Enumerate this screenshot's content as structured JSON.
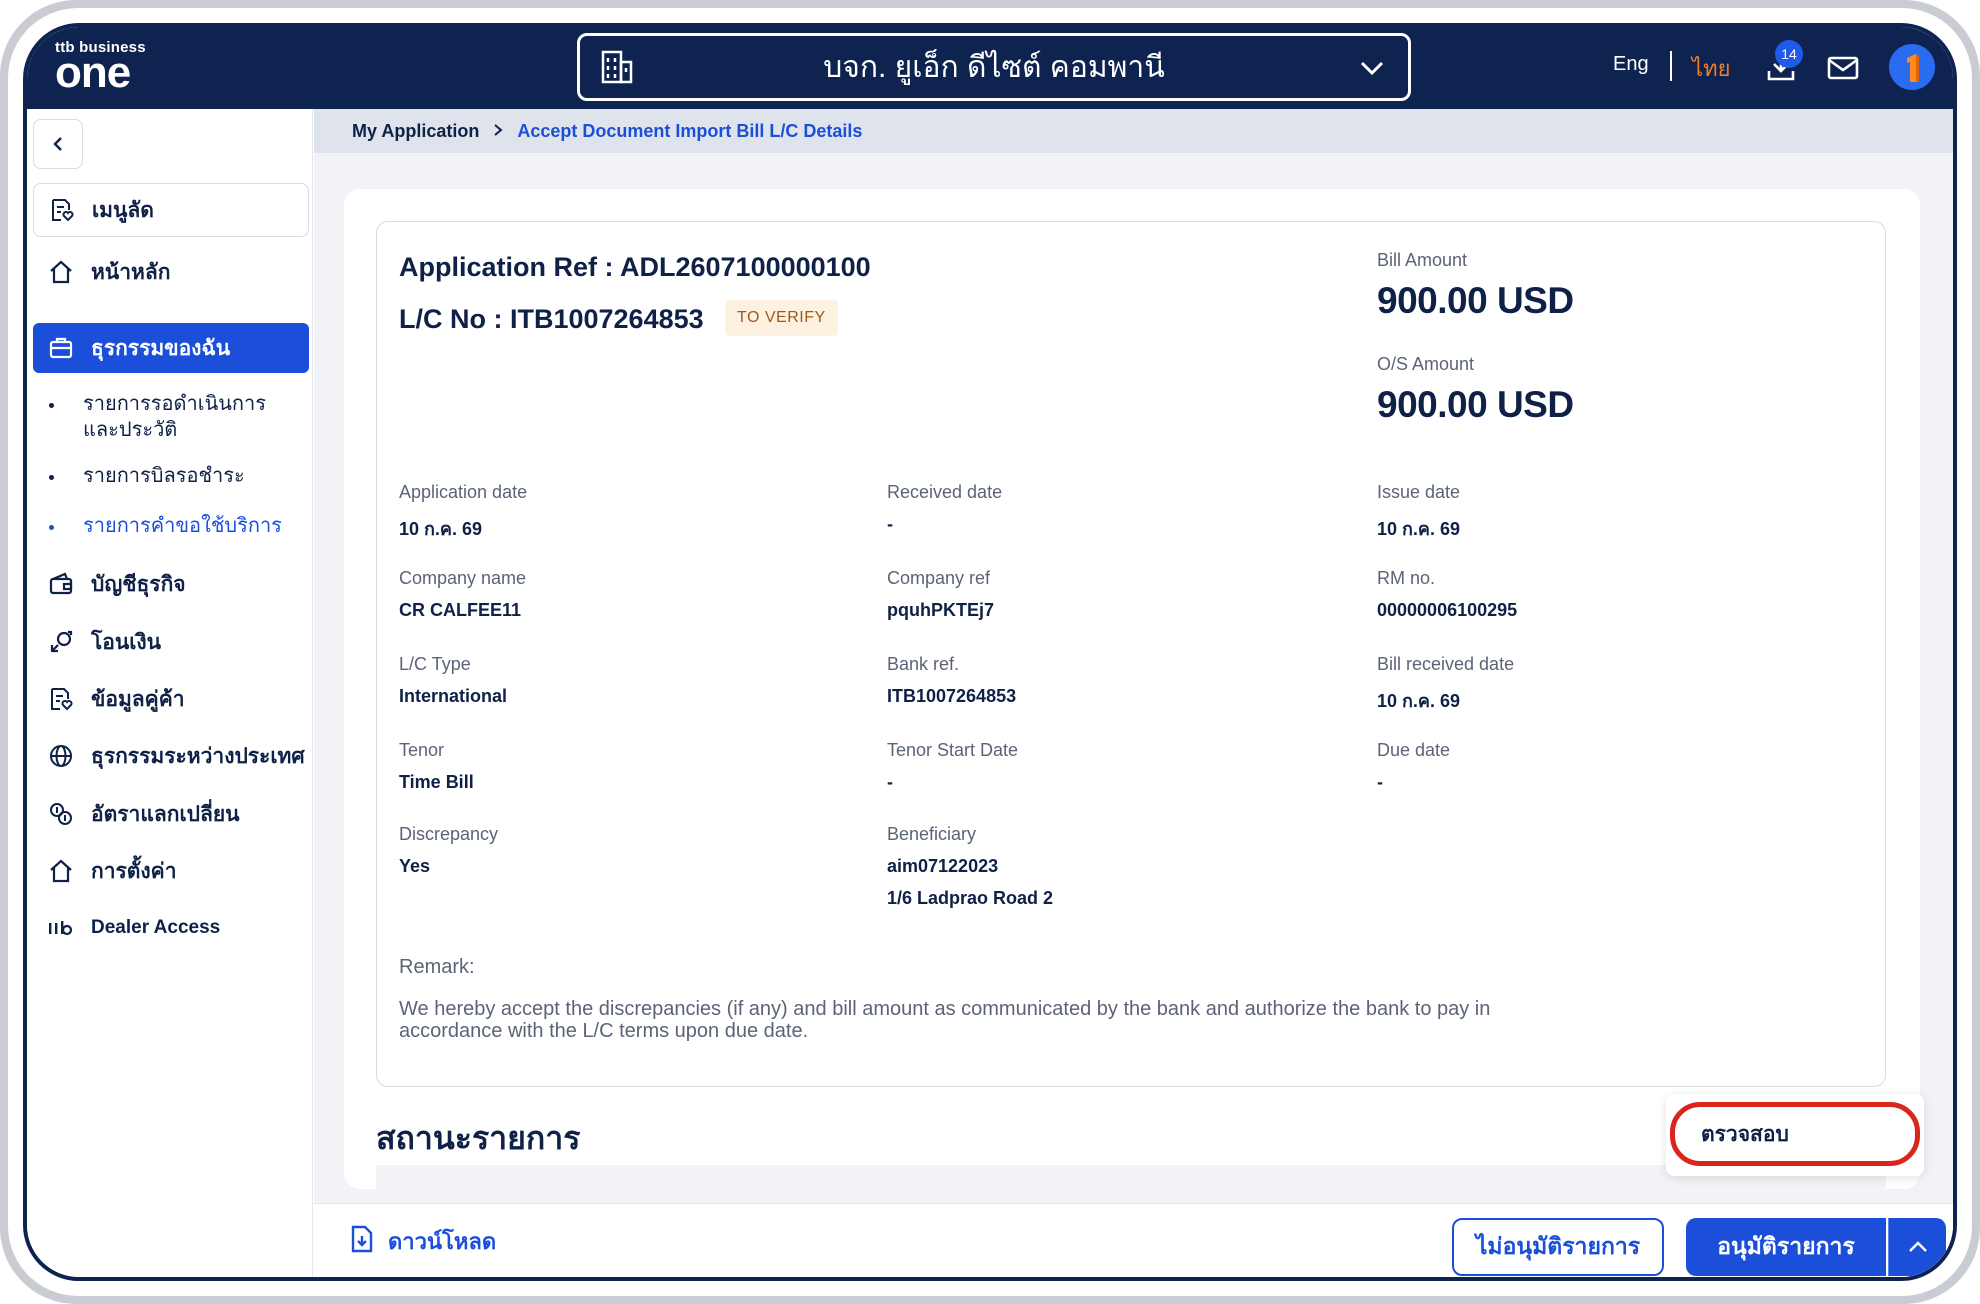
{
  "header": {
    "logo_small": "ttb business",
    "logo_big": "one",
    "company_name": "บจก. ยูเอ็ก ดีไซต์ คอมพานี",
    "lang_en": "Eng",
    "lang_th": "ไทย",
    "download_badge": "14"
  },
  "sidebar": {
    "shortcut_label": "เมนูลัด",
    "items": [
      {
        "label": "หน้าหลัก"
      },
      {
        "label": "ธุรกรรมของฉัน"
      },
      {
        "label": "บัญชีธุรกิจ"
      },
      {
        "label": "โอนเงิน"
      },
      {
        "label": "ข้อมูลคู่ค้า"
      },
      {
        "label": "ธุรกรรมระหว่างประเทศ"
      },
      {
        "label": "อัตราแลกเปลี่ยน"
      },
      {
        "label": "การตั้งค่า"
      },
      {
        "label": "Dealer Access"
      }
    ],
    "sub_items": [
      {
        "label": "รายการรอดำเนินการ และประวัติ"
      },
      {
        "label": "รายการบิลรอชำระ"
      },
      {
        "label": "รายการคำขอใช้บริการ"
      }
    ]
  },
  "breadcrumb": {
    "parent": "My Application",
    "current": "Accept Document Import Bill L/C Details"
  },
  "details": {
    "app_ref": "Application Ref : ADL2607100000100",
    "lc_no": "L/C No : ITB1007264853",
    "status": "TO VERIFY",
    "bill_amount_label": "Bill Amount",
    "bill_amount": "900.00 USD",
    "os_amount_label": "O/S Amount",
    "os_amount": "900.00 USD",
    "fields": [
      {
        "label": "Application date",
        "value": "10 ก.ค. 69"
      },
      {
        "label": "Received date",
        "value": "-"
      },
      {
        "label": "Issue date",
        "value": "10 ก.ค. 69"
      },
      {
        "label": "Company name",
        "value": "CR CALFEE11"
      },
      {
        "label": "Company ref",
        "value": "pquhPKTEj7"
      },
      {
        "label": "RM no.",
        "value": "00000006100295"
      },
      {
        "label": "L/C Type",
        "value": "International"
      },
      {
        "label": "Bank ref.",
        "value": "ITB1007264853"
      },
      {
        "label": "Bill received date",
        "value": "10 ก.ค. 69"
      },
      {
        "label": "Tenor",
        "value": "Time Bill"
      },
      {
        "label": "Tenor Start Date",
        "value": "-"
      },
      {
        "label": "Due date",
        "value": "-"
      },
      {
        "label": "Discrepancy",
        "value": "Yes"
      },
      {
        "label": "Beneficiary",
        "value": "aim07122023",
        "value2": "1/6 Ladprao Road 2"
      }
    ],
    "remark_label": "Remark:",
    "remark_text": "We hereby accept the discrepancies (if any) and bill amount as communicated by the bank and authorize the bank to pay in accordance with the L/C terms upon due date."
  },
  "status_section": {
    "title": "สถานะรายการ"
  },
  "actions": {
    "download": "ดาวน์โหลด",
    "reject": "ไม่อนุมัติรายการ",
    "approve": "อนุมัติรายการ",
    "menu_item": "ตรวจสอบ"
  },
  "colors": {
    "navy": "#0e2350",
    "primary_blue": "#1b4fd9",
    "accent_orange": "#f47b20",
    "highlight_red": "#d9261c"
  }
}
